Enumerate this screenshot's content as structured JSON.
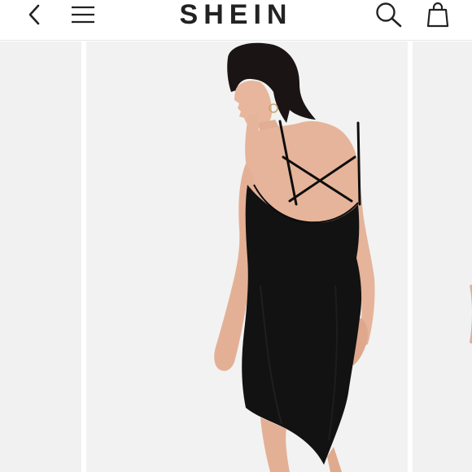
{
  "header": {
    "brand": "SHEIN",
    "icons": {
      "back": "chevron-left-icon",
      "menu": "hamburger-menu-icon",
      "search": "search-icon",
      "bag": "shopping-bag-icon"
    }
  },
  "colors": {
    "text": "#222222",
    "header_bg": "#ffffff",
    "image_bg": "#f2f2f2",
    "dress": "#111111",
    "skin": "#e8b8a0",
    "hair": "#1a1414"
  },
  "carousel": {
    "slides_visible": 3
  }
}
